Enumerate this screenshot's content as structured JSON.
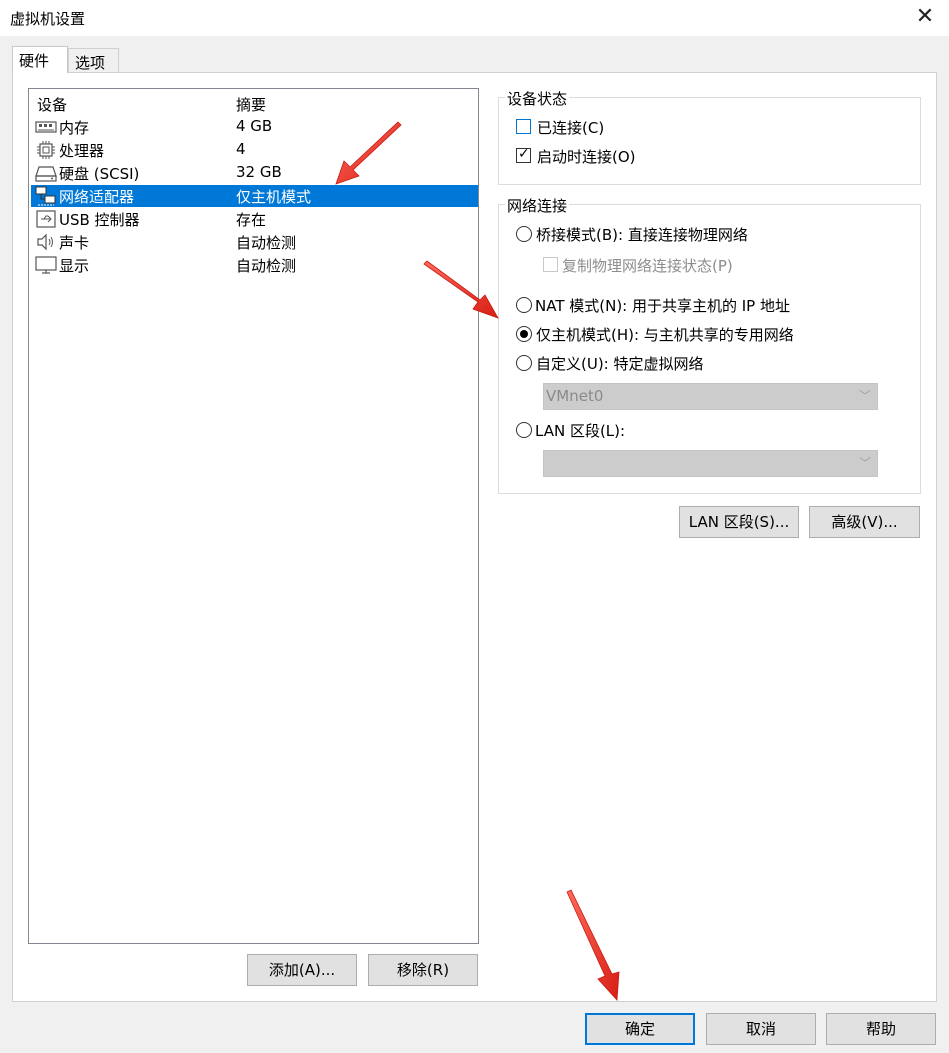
{
  "window": {
    "title": "虚拟机设置",
    "close_glyph": "✕"
  },
  "tabs": [
    {
      "label": "硬件",
      "active": true
    },
    {
      "label": "选项",
      "active": false
    }
  ],
  "device_list": {
    "headers": {
      "device": "设备",
      "summary": "摘要"
    },
    "items": [
      {
        "icon": "memory-icon",
        "name": "内存",
        "summary": "4 GB",
        "selected": false
      },
      {
        "icon": "processor-icon",
        "name": "处理器",
        "summary": "4",
        "selected": false
      },
      {
        "icon": "hard-disk-icon",
        "name": "硬盘 (SCSI)",
        "summary": "32 GB",
        "selected": false
      },
      {
        "icon": "network-adapter-icon",
        "name": "网络适配器",
        "summary": "仅主机模式",
        "selected": true
      },
      {
        "icon": "usb-icon",
        "name": "USB 控制器",
        "summary": "存在",
        "selected": false
      },
      {
        "icon": "sound-icon",
        "name": "声卡",
        "summary": "自动检测",
        "selected": false
      },
      {
        "icon": "display-icon",
        "name": "显示",
        "summary": "自动检测",
        "selected": false
      }
    ]
  },
  "list_buttons": {
    "add": "添加(A)...",
    "remove": "移除(R)"
  },
  "device_status": {
    "label": "设备状态",
    "connected": {
      "label": "已连接(C)",
      "checked": false
    },
    "connect_at_power_on": {
      "label": "启动时连接(O)",
      "checked": true
    }
  },
  "network_connection": {
    "label": "网络连接",
    "bridged": {
      "label": "桥接模式(B): 直接连接物理网络",
      "selected": false
    },
    "replicate": {
      "label": "复制物理网络连接状态(P)",
      "checked": false,
      "disabled": true
    },
    "nat": {
      "label": "NAT 模式(N): 用于共享主机的 IP 地址",
      "selected": false
    },
    "host_only": {
      "label": "仅主机模式(H): 与主机共享的专用网络",
      "selected": true
    },
    "custom": {
      "label": "自定义(U): 特定虚拟网络",
      "selected": false
    },
    "custom_select_value": "VMnet0",
    "lan_segment": {
      "label": "LAN 区段(L):",
      "selected": false
    },
    "lan_select_value": ""
  },
  "side_buttons": {
    "lan_segments": "LAN 区段(S)...",
    "advanced": "高级(V)..."
  },
  "footer_buttons": {
    "ok": "确定",
    "cancel": "取消",
    "help": "帮助"
  },
  "colors": {
    "selection": "#0078d7",
    "arrow": "#e8271e",
    "background": "#f0f0f0"
  }
}
